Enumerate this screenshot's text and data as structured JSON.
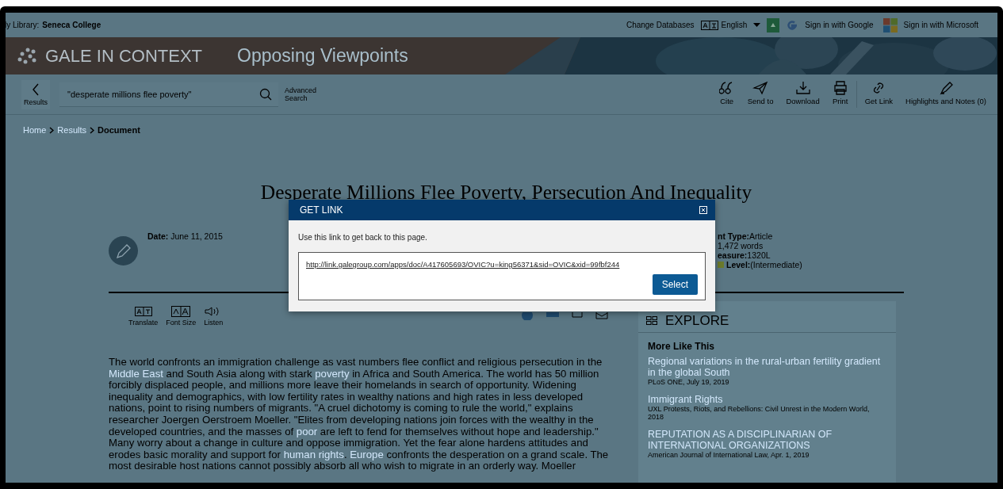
{
  "library_bar": {
    "library_label": "ly Library:",
    "library_name": "Seneca College",
    "change_databases": "Change Databases",
    "language": "English",
    "sign_in": [
      {
        "label": "Sign in with Google",
        "kind": "google"
      },
      {
        "label": "Sign in with Microsoft",
        "kind": "microsoft"
      }
    ]
  },
  "banner": {
    "brand": "GALE IN CONTEXT",
    "product": "Opposing Viewpoints"
  },
  "toolbar": {
    "back_label": "Results",
    "search_value": "\"desperate millions flee poverty\"",
    "advanced_search": "Advanced Search",
    "tools": [
      {
        "label": "Cite",
        "kind": "cite"
      },
      {
        "label": "Send to",
        "kind": "send"
      },
      {
        "label": "Download",
        "kind": "download"
      },
      {
        "label": "Print",
        "kind": "print"
      },
      {
        "label": "Get Link",
        "kind": "link"
      },
      {
        "label": "Highlights and Notes (0)",
        "kind": "highlight"
      }
    ]
  },
  "breadcrumb": [
    {
      "label": "Home",
      "current": false
    },
    {
      "label": "Results",
      "current": false
    },
    {
      "label": "Document",
      "current": true
    }
  ],
  "document": {
    "title": "Desperate Millions Flee Poverty, Persecution And Inequality",
    "date_label": "Date:",
    "date": "June 11, 2015",
    "meta": [
      {
        "label": "nt Type:",
        "value": "Article"
      },
      {
        "value": "1,472 words"
      },
      {
        "label": "easure:",
        "value": "1320L"
      },
      {
        "label": "Level:",
        "value": "(Intermediate)",
        "color": "#6b7a2c"
      }
    ],
    "reader_tools": [
      {
        "label": "Translate",
        "kind": "translate"
      },
      {
        "label": "Font Size",
        "kind": "fontsize"
      },
      {
        "label": "Listen",
        "kind": "listen"
      }
    ],
    "body": [
      {
        "text": "The world confronts an immigration challenge as vast numbers flee conflict and religious persecution in the ",
        "kind": "text"
      },
      {
        "text": "Middle East",
        "kind": "link"
      },
      {
        "text": " and South Asia along with stark ",
        "kind": "text"
      },
      {
        "text": "poverty",
        "kind": "link"
      },
      {
        "text": " in Africa and South America. The world has 50 million forcibly displaced people, and millions more leave their homelands in search of opportunity. Widening inequality and demographics, with low fertility rates in wealthy nations and high rates in less developed nations, point to rising numbers of migrants. \"A cruel dichotomy is coming to rule the world,\" explains researcher Joergen Oerstroem Moeller. \"Elites from developing nations join forces with the wealthy in the developed countries, and the masses of ",
        "kind": "text"
      },
      {
        "text": "poor",
        "kind": "link"
      },
      {
        "text": " are left to fend for themselves without hope and leadership.\" Many worry about a change in culture and oppose immigration. Yet the fear alone hardens attitudes and erodes basic morality and support for ",
        "kind": "text"
      },
      {
        "text": "human rights",
        "kind": "link"
      },
      {
        "text": ". ",
        "kind": "text"
      },
      {
        "text": "Europe",
        "kind": "link"
      },
      {
        "text": " confronts the desperation on a grand scale. The most desirable host nations cannot possibly absorb all who wish to migrate in an orderly way. Moeller",
        "kind": "text"
      }
    ]
  },
  "sidebar": {
    "heading": "EXPLORE",
    "section": "More Like This",
    "items": [
      {
        "title": "Regional variations in the rural-urban fertility gradient in the global South",
        "source": "PLoS ONE, July 19, 2019"
      },
      {
        "title": "Immigrant Rights",
        "source": "UXL Protests, Riots, and Rebellions: Civil Unrest in the Modern World, 2018"
      },
      {
        "title": "REPUTATION AS A DISCIPLINARIAN OF INTERNATIONAL ORGANIZATIONS",
        "source": "American Journal of International Law, Apr. 1, 2019"
      }
    ]
  },
  "modal": {
    "title": "GET LINK",
    "instruction": "Use this link to get back to this page.",
    "url": "http://link.galegroup.com/apps/doc/A417605693/OVIC?u=king56371&sid=OVIC&xid=99fbf244",
    "select_label": "Select"
  }
}
